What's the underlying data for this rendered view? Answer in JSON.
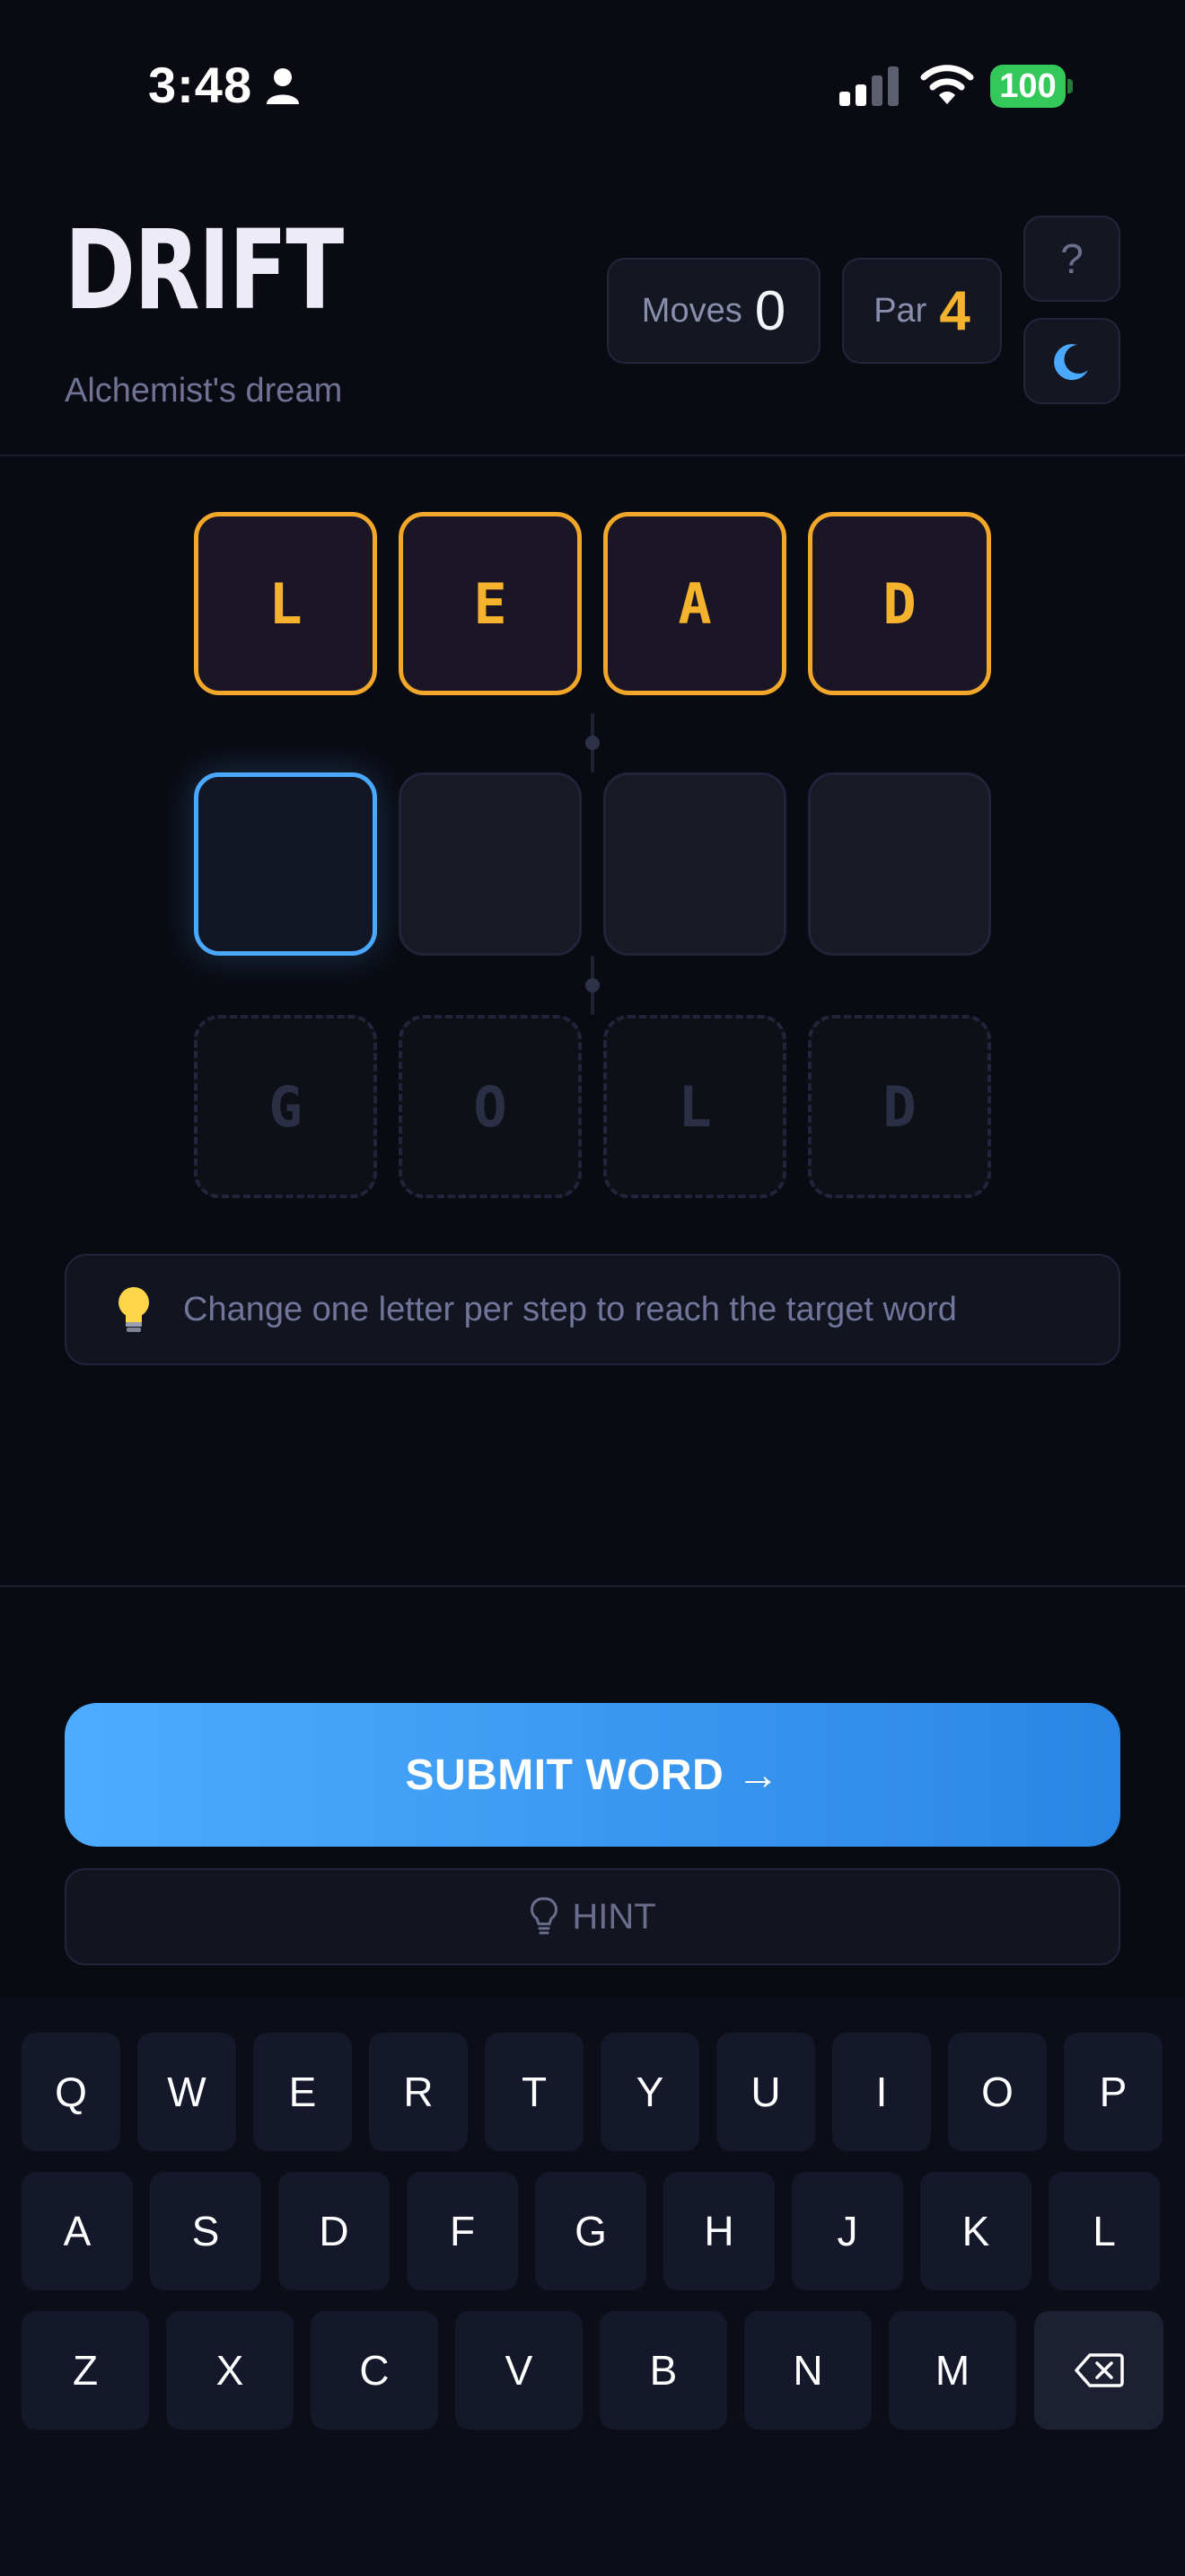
{
  "status_bar": {
    "time": "3:48",
    "battery": "100"
  },
  "header": {
    "title": "DRIFT",
    "subtitle": "Alchemist's dream",
    "moves_label": "Moves",
    "moves_value": "0",
    "par_label": "Par",
    "par_value": "4",
    "help_label": "?"
  },
  "board": {
    "start_word": [
      "L",
      "E",
      "A",
      "D"
    ],
    "target_word": [
      "G",
      "O",
      "L",
      "D"
    ]
  },
  "instruction": {
    "text": "Change one letter per step to reach the target word"
  },
  "actions": {
    "submit_label": "SUBMIT WORD →",
    "hint_label": "HINT"
  },
  "keyboard": {
    "row1": [
      "Q",
      "W",
      "E",
      "R",
      "T",
      "Y",
      "U",
      "I",
      "O",
      "P"
    ],
    "row2": [
      "A",
      "S",
      "D",
      "F",
      "G",
      "H",
      "J",
      "K",
      "L"
    ],
    "row3": [
      "Z",
      "X",
      "C",
      "V",
      "B",
      "N",
      "M"
    ]
  },
  "colors": {
    "accent_blue": "#4aa8ff",
    "accent_gold": "#f5b22d",
    "background": "#0a0b12"
  },
  "icons": [
    "person-icon",
    "signal-icon",
    "wifi-icon",
    "moon-icon",
    "lightbulb-icon",
    "backspace-icon"
  ]
}
